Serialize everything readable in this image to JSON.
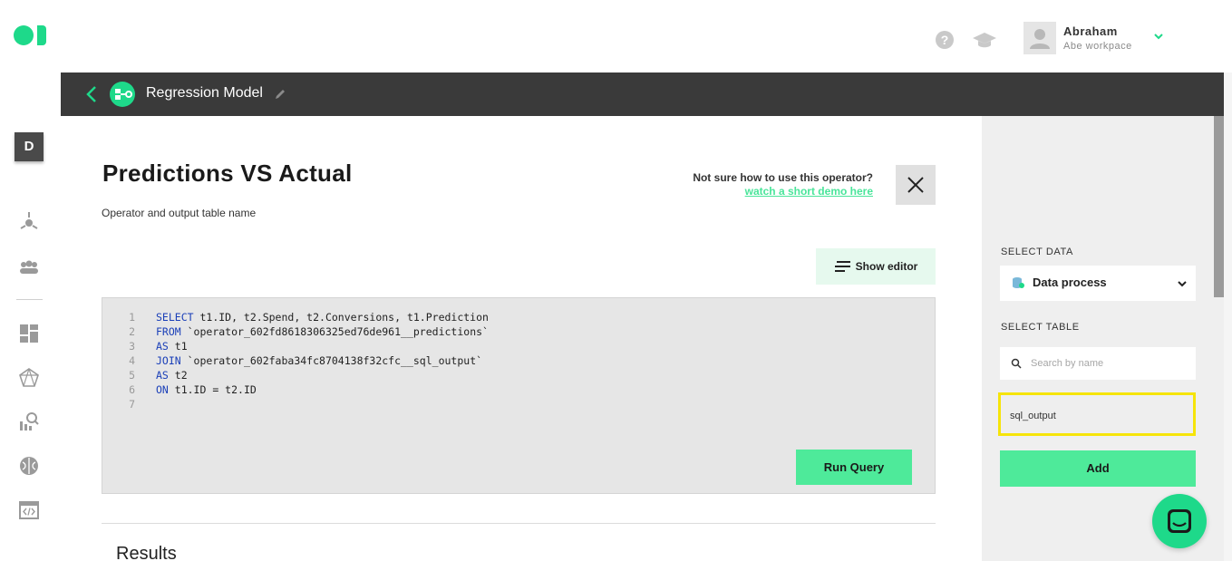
{
  "header": {
    "help_icon_glyph": "?",
    "user": {
      "name": "Abraham",
      "workspace": "Abe workpace"
    }
  },
  "rail": {
    "workspace_letter": "D",
    "icons": [
      "data-source-icon",
      "audience-icon",
      "dashboard-icon",
      "network-icon",
      "analytics-icon",
      "brain-icon",
      "code-icon"
    ]
  },
  "titlebar": {
    "title": "Regression Model"
  },
  "operator": {
    "title": "Predictions VS Actual",
    "subtitle": "Operator and output table name",
    "help_question": "Not sure how to use this operator?",
    "help_link": "watch a short demo here",
    "show_editor_label": "Show editor"
  },
  "editor": {
    "lines": [
      {
        "n": "1",
        "kw": "SELECT",
        "rest": " t1.ID, t2.Spend, t2.Conversions, t1.Prediction"
      },
      {
        "n": "2",
        "kw": "FROM",
        "rest": " `operator_602fd8618306325ed76de961__predictions`"
      },
      {
        "n": "3",
        "kw": "AS",
        "rest": " t1"
      },
      {
        "n": "4",
        "kw": "JOIN",
        "rest": " `operator_602faba34fc8704138f32cfc__sql_output`"
      },
      {
        "n": "5",
        "kw": "AS",
        "rest": " t2"
      },
      {
        "n": "6",
        "kw": "ON",
        "rest": " t1.ID = t2.ID"
      },
      {
        "n": "7",
        "kw": "",
        "rest": ""
      }
    ],
    "run_label": "Run Query"
  },
  "results": {
    "title": "Results"
  },
  "right_panel": {
    "select_data_label": "SELECT DATA",
    "data_value": "Data process",
    "select_table_label": "SELECT TABLE",
    "search_placeholder": "Search by name",
    "search_value": "",
    "tables": [
      "sql_output"
    ],
    "add_label": "Add"
  },
  "colors": {
    "accent": "#1ed98a",
    "button_green": "#4eea9a",
    "titlebar": "#3a3a3a",
    "highlight_border": "#f6e409",
    "sql_keyword": "#1a3fb8"
  }
}
